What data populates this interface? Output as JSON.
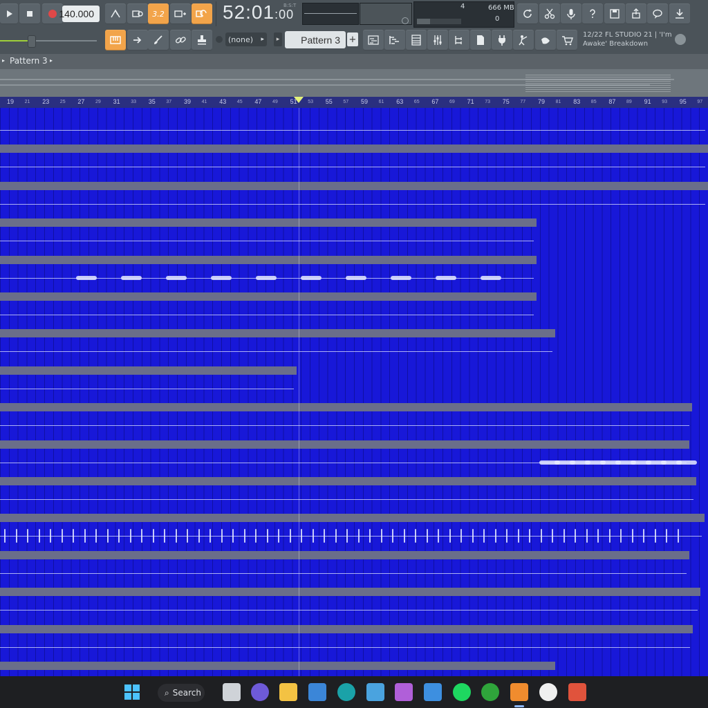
{
  "toolbar": {
    "tempo": "140.000",
    "time_main": "52:01",
    "time_sub": ":00",
    "time_mode": "B:S:T",
    "cpu_value": "4",
    "memory": "666 MB",
    "polyphony": "0",
    "snap_value": "(none)",
    "pattern": "Pattern 3",
    "hint_line1": "12/22  FL STUDIO 21 | 'I'm",
    "hint_line2": "Awake' Breakdown",
    "accent": "#f2a44a",
    "step_label": "3.2"
  },
  "playlist": {
    "title": "Pattern 3",
    "clip_color": "#1818d8",
    "bar_numbers": [
      "19",
      "21",
      "23",
      "25",
      "27",
      "29",
      "31",
      "33",
      "35",
      "37",
      "39",
      "41",
      "43",
      "45",
      "47",
      "49",
      "51",
      "53",
      "55",
      "57",
      "59",
      "61",
      "63",
      "65",
      "67",
      "69",
      "71",
      "73",
      "75",
      "77",
      "79",
      "81",
      "83",
      "85",
      "87",
      "89",
      "91",
      "93",
      "95",
      "97"
    ]
  },
  "taskbar": {
    "search_label": "Search"
  }
}
